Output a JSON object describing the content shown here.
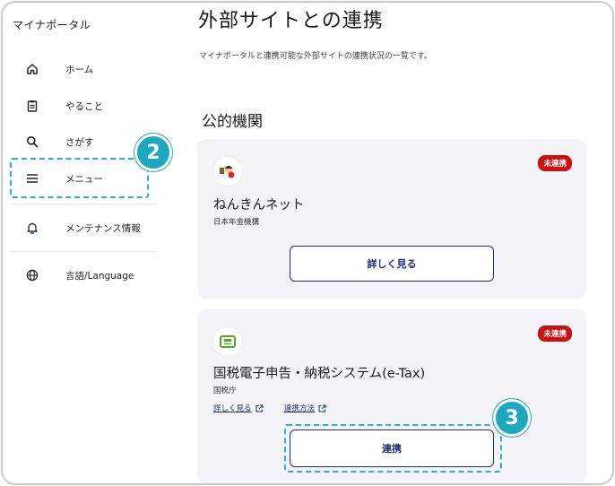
{
  "sidebar": {
    "brand": "マイナポータル",
    "items": [
      {
        "label": "ホーム",
        "icon": "home-icon"
      },
      {
        "label": "やること",
        "icon": "clipboard-icon"
      },
      {
        "label": "さがす",
        "icon": "search-icon"
      },
      {
        "label": "メニュー",
        "icon": "menu-icon"
      },
      {
        "label": "メンテナンス情報",
        "icon": "bell-icon"
      },
      {
        "label": "言語/Language",
        "icon": "globe-icon"
      }
    ]
  },
  "annotations": {
    "step2": "2",
    "step3": "3"
  },
  "main": {
    "title": "外部サイトとの連携",
    "description": "マイナポータルと連携可能な外部サイトの連携状況の一覧です。",
    "section_title": "公的機関",
    "cards": [
      {
        "name": "ねんきんネット",
        "org": "日本年金機構",
        "status": "未連携",
        "button": "詳しく見る"
      },
      {
        "name": "国税電子申告・納税システム(e-Tax)",
        "org": "国税庁",
        "status": "未連携",
        "link1": "詳しく見る",
        "link2": "連携方法",
        "button": "連携"
      }
    ]
  },
  "colors": {
    "accent": "#1f2f73",
    "badge": "#cc1010",
    "annotation": "#1ca9bf"
  }
}
